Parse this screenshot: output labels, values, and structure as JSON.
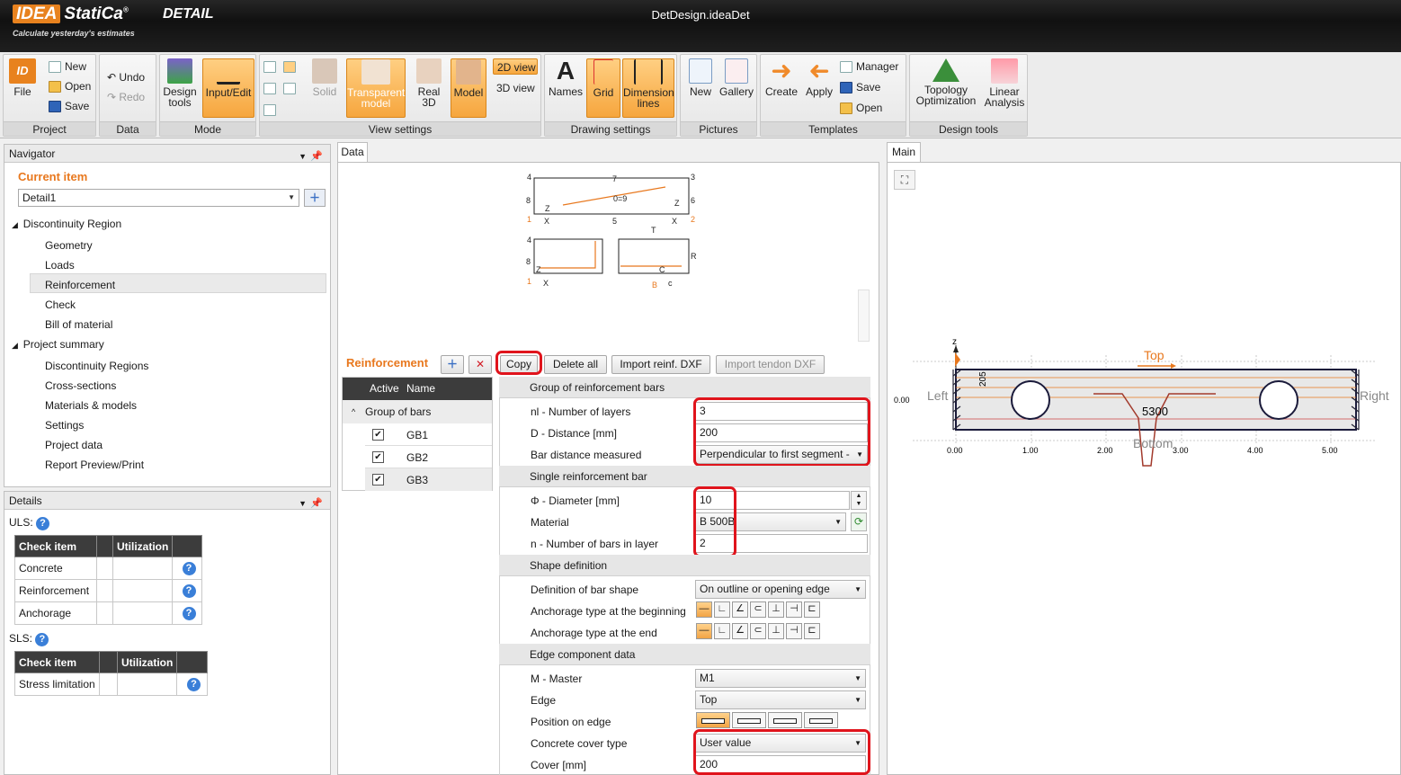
{
  "titlebar": {
    "brand_mark": "IDEA",
    "brand_name": "StatiCa",
    "product": "DETAIL",
    "tagline": "Calculate yesterday's estimates",
    "document": "DetDesign.ideaDet"
  },
  "ribbon": {
    "project": {
      "label": "Project",
      "file": "File",
      "new": "New",
      "open": "Open",
      "save": "Save"
    },
    "data": {
      "label": "Data",
      "undo": "Undo",
      "redo": "Redo"
    },
    "mode": {
      "label": "Mode",
      "design_tools_1": "Design",
      "design_tools_2": "tools",
      "input_edit": "Input/Edit"
    },
    "view": {
      "label": "View settings",
      "solid": "Solid",
      "transparent_1": "Transparent",
      "transparent_2": "model",
      "real3d_1": "Real",
      "real3d_2": "3D",
      "model": "Model",
      "view2d": "2D view",
      "view3d": "3D view"
    },
    "drawing": {
      "label": "Drawing settings",
      "names": "Names",
      "grid": "Grid",
      "dim_1": "Dimension",
      "dim_2": "lines"
    },
    "pictures": {
      "label": "Pictures",
      "new": "New",
      "gallery": "Gallery"
    },
    "templates": {
      "label": "Templates",
      "create": "Create",
      "apply": "Apply",
      "manager": "Manager",
      "save": "Save",
      "open": "Open"
    },
    "design_tools": {
      "label": "Design tools",
      "topo_1": "Topology",
      "topo_2": "Optimization",
      "linear_1": "Linear",
      "linear_2": "Analysis"
    }
  },
  "navigator": {
    "title": "Navigator",
    "current_item": "Current item",
    "detail": "Detail1",
    "tree": [
      "Discontinuity Region",
      "Geometry",
      "Loads",
      "Reinforcement",
      "Check",
      "Bill of material",
      "Project summary",
      "Discontinuity Regions",
      "Cross-sections",
      "Materials & models",
      "Settings",
      "Project data",
      "Report Preview/Print"
    ]
  },
  "details": {
    "title": "Details",
    "uls": "ULS:",
    "sls": "SLS:",
    "col_check": "Check item",
    "col_util": "Utilization",
    "uls_rows": [
      "Concrete",
      "Reinforcement",
      "Anchorage"
    ],
    "sls_rows": [
      "Stress limitation"
    ]
  },
  "data_tab": "Data",
  "main_tab": "Main",
  "sketch": {
    "l4a": "4",
    "l7": "7",
    "l3": "3",
    "l8a": "8",
    "l6": "6",
    "l09": "0=9",
    "z1": "Z",
    "z2": "Z",
    "l1": "1",
    "l2": "2",
    "x1": "X",
    "l5": "5",
    "x2": "X",
    "t": "T",
    "l4b": "4",
    "l8b": "8",
    "r": "R",
    "z1b": "Z",
    "l1b": "1",
    "x1b": "X",
    "b": "B",
    "c": "C",
    "cb": "c"
  },
  "reinforcement": {
    "title": "Reinforcement",
    "copy": "Copy",
    "delete_all": "Delete all",
    "import_reinf": "Import reinf. DXF",
    "import_tendon": "Import tendon DXF",
    "list_head_active": "Active",
    "list_head_name": "Name",
    "group": "Group of bars",
    "bars": [
      "GB1",
      "GB2",
      "GB3"
    ]
  },
  "props": {
    "sec_group": "Group of reinforcement bars",
    "nl_label": "nl - Number of layers",
    "nl_value": "3",
    "d_label": "D - Distance [mm]",
    "d_value": "200",
    "bdm_label": "Bar distance measured",
    "bdm_value": "Perpendicular to first segment -",
    "sec_single": "Single reinforcement bar",
    "dia_label": "Φ - Diameter [mm]",
    "dia_value": "10",
    "mat_label": "Material",
    "mat_value": "B 500B",
    "n_label": "n - Number of bars in layer",
    "n_value": "2",
    "sec_shape": "Shape definition",
    "def_label": "Definition of bar shape",
    "def_value": "On outline or opening edge",
    "anch_begin": "Anchorage type at the beginning",
    "anch_end": "Anchorage type at the end",
    "sec_edge": "Edge component data",
    "master_label": "M - Master",
    "master_value": "M1",
    "edge_label": "Edge",
    "edge_value": "Top",
    "pos_label": "Position on edge",
    "cover_type_label": "Concrete cover type",
    "cover_type_value": "User value",
    "cover_label": "Cover [mm]",
    "cover_value": "200"
  },
  "drawing": {
    "z": "z",
    "top": "Top",
    "left": "Left",
    "right": "Right",
    "bottom": "Bottom",
    "dim205": "205",
    "dim5300": "5300",
    "y0": "0.00",
    "ticks": [
      "0.00",
      "1.00",
      "2.00",
      "3.00",
      "4.00",
      "5.00"
    ]
  },
  "colors": {
    "accent": "#e8781e",
    "highlight": "#e0141c",
    "ribbon_active": "#f6a63e"
  }
}
